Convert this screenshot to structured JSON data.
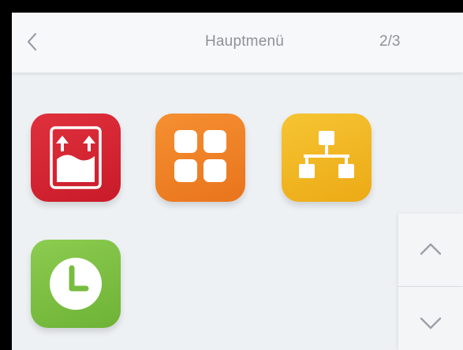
{
  "header": {
    "title": "Hauptmenü",
    "page_indicator": "2/3",
    "back_icon": "chevron-left-icon"
  },
  "tiles": [
    {
      "name": "upload-tile",
      "icon": "box-up-arrows-icon",
      "color": "#d3222f"
    },
    {
      "name": "grid-tile",
      "icon": "four-squares-icon",
      "color": "#ee7f22"
    },
    {
      "name": "network-tile",
      "icon": "network-tree-icon",
      "color": "#f0b41e"
    },
    {
      "name": "clock-tile",
      "icon": "clock-icon",
      "color": "#79c043"
    }
  ],
  "scroll": {
    "up_icon": "chevron-up-icon",
    "down_icon": "chevron-down-icon"
  }
}
